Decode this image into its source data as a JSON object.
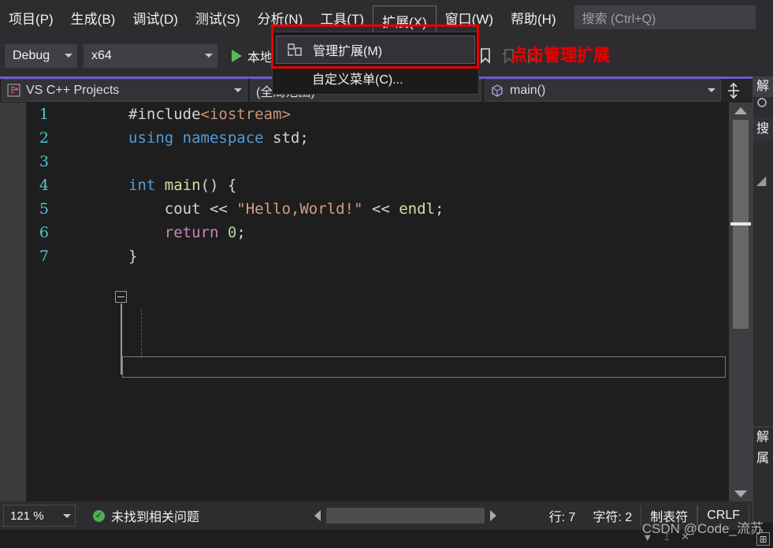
{
  "menubar": {
    "items": [
      {
        "label": "项目(P)",
        "name": "menu-project"
      },
      {
        "label": "生成(B)",
        "name": "menu-build"
      },
      {
        "label": "调试(D)",
        "name": "menu-debug"
      },
      {
        "label": "测试(S)",
        "name": "menu-test"
      },
      {
        "label": "分析(N)",
        "name": "menu-analyze"
      },
      {
        "label": "工具(T)",
        "name": "menu-tools"
      },
      {
        "label": "扩展(X)",
        "name": "menu-extensions"
      },
      {
        "label": "窗口(W)",
        "name": "menu-window"
      },
      {
        "label": "帮助(H)",
        "name": "menu-help"
      }
    ],
    "search_placeholder": "搜索 (Ctrl+Q)"
  },
  "dropdown": {
    "items": [
      {
        "label": "管理扩展(M)",
        "icon": "manage-extensions-icon",
        "highlighted": true
      },
      {
        "label": "自定义菜单(C)...",
        "icon": "",
        "highlighted": false
      }
    ]
  },
  "annotations": {
    "toolbar_text": "点击管理扩展",
    "red_color": "#e60000"
  },
  "toolbar": {
    "configuration": "Debug",
    "platform": "x64",
    "run_label": "本地",
    "icons": [
      {
        "name": "folder-search-icon"
      },
      {
        "name": "save-icon"
      },
      {
        "name": "save-all-icon"
      },
      {
        "name": "comment-icon"
      },
      {
        "name": "uncomment-icon"
      },
      {
        "name": "bookmark-icon"
      },
      {
        "name": "bookmark-prev-icon"
      },
      {
        "name": "bookmark-next-icon"
      }
    ]
  },
  "navbar": {
    "project": "VS C++ Projects",
    "scope": "(全局范围)",
    "member": "main()",
    "split_icon": "split-editor-icon"
  },
  "editor": {
    "lines": [
      {
        "num": "1",
        "tokens": [
          {
            "t": "#include",
            "c": "t-pre"
          },
          {
            "t": "<iostream>",
            "c": "t-inc"
          }
        ]
      },
      {
        "num": "2",
        "tokens": [
          {
            "t": "using",
            "c": "t-kw"
          },
          {
            "t": " ",
            "c": "t-plain"
          },
          {
            "t": "namespace",
            "c": "t-kw"
          },
          {
            "t": " std;",
            "c": "t-plain"
          }
        ]
      },
      {
        "num": "3",
        "tokens": []
      },
      {
        "num": "4",
        "tokens": [
          {
            "t": "int",
            "c": "t-kw"
          },
          {
            "t": " ",
            "c": "t-plain"
          },
          {
            "t": "main",
            "c": "t-fn"
          },
          {
            "t": "() {",
            "c": "t-plain"
          }
        ]
      },
      {
        "num": "5",
        "tokens": [
          {
            "t": "    cout",
            "c": "t-plain"
          },
          {
            "t": " << ",
            "c": "t-op"
          },
          {
            "t": "\"Hello,World!\"",
            "c": "t-str"
          },
          {
            "t": " << ",
            "c": "t-op"
          },
          {
            "t": "endl",
            "c": "t-fn"
          },
          {
            "t": ";",
            "c": "t-plain"
          }
        ]
      },
      {
        "num": "6",
        "tokens": [
          {
            "t": "    ",
            "c": "t-plain"
          },
          {
            "t": "return",
            "c": "t-ctl"
          },
          {
            "t": " ",
            "c": "t-plain"
          },
          {
            "t": "0",
            "c": "t-num"
          },
          {
            "t": ";",
            "c": "t-plain"
          }
        ]
      },
      {
        "num": "7",
        "tokens": [
          {
            "t": "}",
            "c": "t-plain"
          }
        ]
      }
    ]
  },
  "rightpanel": {
    "rows": [
      "解",
      "搜",
      "解",
      "属"
    ]
  },
  "statusbar": {
    "zoom": "121 %",
    "problems": "未找到相关问题",
    "line_label": "行: 7",
    "char_label": "字符: 2",
    "tab_label": "制表符",
    "eol_label": "CRLF"
  },
  "watermark": "CSDN @Code_流苏"
}
